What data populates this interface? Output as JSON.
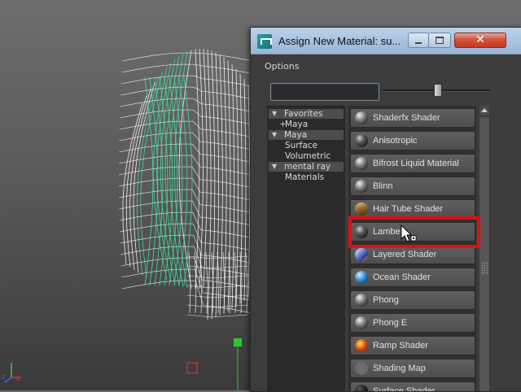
{
  "dialog": {
    "title": "Assign New Material: su...",
    "close_label": "✕",
    "options_label": "Options",
    "filter_value": ""
  },
  "tree": {
    "favorites": "Favorites",
    "favorites_maya": "Maya",
    "maya": "Maya",
    "surface": "Surface",
    "volumetric": "Volumetric",
    "mental_ray": "mental ray",
    "materials": "Materials"
  },
  "shaders": [
    {
      "label": "Shaderfx Shader",
      "icon": "sphere-swatch-icon",
      "swatch": "grey"
    },
    {
      "label": "Anisotropic",
      "icon": "sphere-swatch-icon",
      "swatch": "dark"
    },
    {
      "label": "Bifrost Liquid Material",
      "icon": "sphere-swatch-icon",
      "swatch": "grey"
    },
    {
      "label": "Blinn",
      "icon": "sphere-swatch-icon",
      "swatch": "grey"
    },
    {
      "label": "Hair Tube Shader",
      "icon": "hair-tube-swatch-icon",
      "swatch": "hair"
    },
    {
      "label": "Lambert",
      "icon": "sphere-swatch-icon",
      "swatch": "dark"
    },
    {
      "label": "Layered Shader",
      "icon": "layered-swatch-icon",
      "swatch": "layer"
    },
    {
      "label": "Ocean Shader",
      "icon": "ocean-swatch-icon",
      "swatch": "ocean"
    },
    {
      "label": "Phong",
      "icon": "sphere-swatch-icon",
      "swatch": "grey"
    },
    {
      "label": "Phong E",
      "icon": "sphere-swatch-icon",
      "swatch": "grey"
    },
    {
      "label": "Ramp Shader",
      "icon": "ramp-swatch-icon",
      "swatch": "ramp"
    },
    {
      "label": "Shading Map",
      "icon": "flat-swatch-icon",
      "swatch": "map"
    },
    {
      "label": "Surface Shader",
      "icon": "sphere-swatch-icon",
      "swatch": "black"
    }
  ],
  "highlighted_shader": "Lambert",
  "colors": {
    "highlight": "#e01010",
    "titlebar": "#a9c3e0",
    "wire_selected": "#3fe0a0",
    "wire_default": "#ffffff"
  }
}
